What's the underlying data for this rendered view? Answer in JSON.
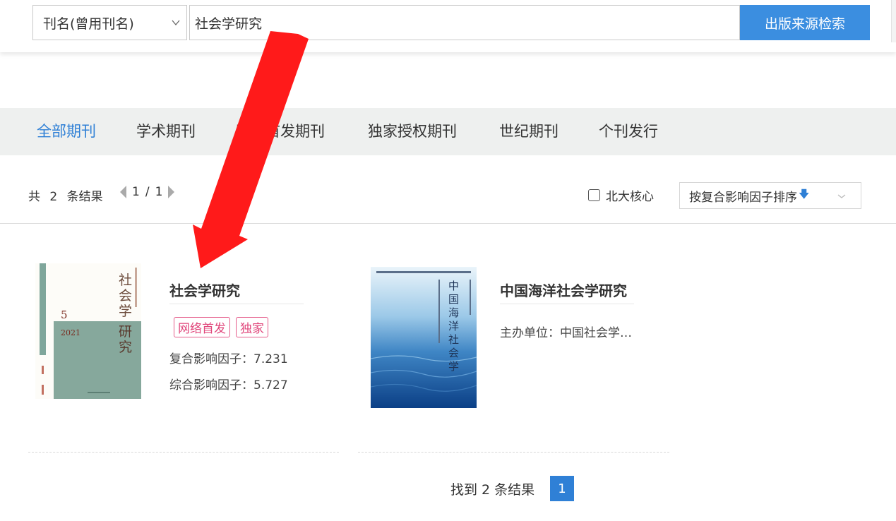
{
  "search": {
    "field_label": "刊名(曾用刊名)",
    "query": "社会学研究",
    "button_label": "出版来源检索"
  },
  "tabs": [
    {
      "label": "全部期刊",
      "active": true
    },
    {
      "label": "学术期刊",
      "active": false
    },
    {
      "label": "网络首发期刊",
      "active": false
    },
    {
      "label": "独家授权期刊",
      "active": false
    },
    {
      "label": "世纪期刊",
      "active": false
    },
    {
      "label": "个刊发行",
      "active": false
    }
  ],
  "results": {
    "prefix": "共",
    "count": "2",
    "suffix": "条结果",
    "page_current": "1",
    "page_sep": "/",
    "page_total": "1"
  },
  "filter": {
    "core_label": "北大核心",
    "sort_label": "按复合影响因子排序"
  },
  "journals": [
    {
      "title": "社会学研究",
      "tags": [
        "网络首发",
        "独家"
      ],
      "metrics": [
        {
          "label": "复合影响因子：",
          "value": "7.231"
        },
        {
          "label": "综合影响因子：",
          "value": "5.727"
        }
      ]
    },
    {
      "title": "中国海洋社会学研究",
      "sponsor": "主办单位：中国社会学…"
    }
  ],
  "footer": {
    "found_text": "找到 2 条结果",
    "page": "1"
  },
  "colors": {
    "accent": "#3b8ee0",
    "active_tab": "#2f80d6",
    "tag": "#e0457a",
    "annotation_arrow": "#ff1a1a"
  }
}
